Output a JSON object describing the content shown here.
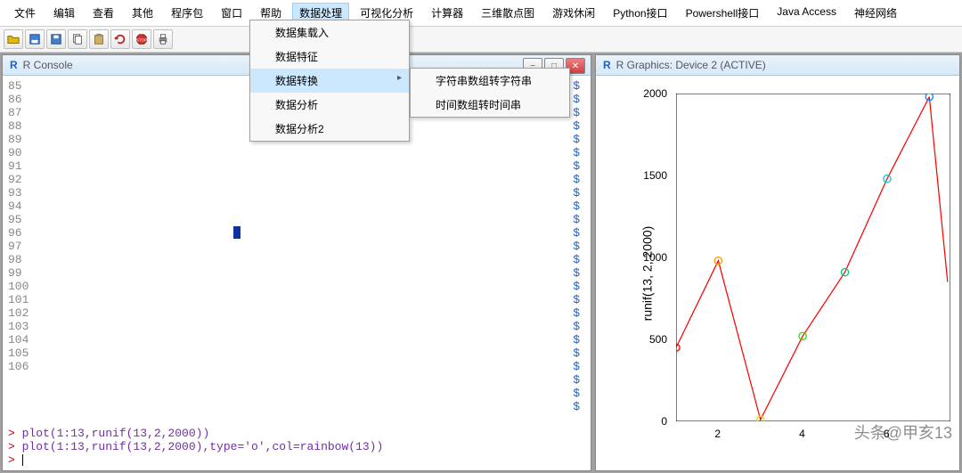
{
  "menubar": [
    "文件",
    "编辑",
    "查看",
    "其他",
    "程序包",
    "窗口",
    "帮助",
    "数据处理",
    "可视化分析",
    "计算器",
    "三维散点图",
    "游戏休闲",
    "Python接口",
    "Powershell接口",
    "Java Access",
    "神经网络"
  ],
  "open_menu_index": 7,
  "dropdown1": [
    "数据集载入",
    "数据特征",
    "数据转换",
    "数据分析",
    "数据分析2"
  ],
  "dropdown1_hover": 2,
  "dropdown2": [
    "字符串数组转字符串",
    "时间数组转时间串"
  ],
  "toolbar_icons": [
    "open-icon",
    "save-as-icon",
    "save-icon",
    "copy-icon",
    "paste-icon",
    "refresh-icon",
    "stop-icon",
    "print-icon"
  ],
  "console": {
    "title": "R Console",
    "line_start": 85,
    "line_end": 106,
    "dollar_count": 25,
    "cmds": [
      "plot(1:13,runif(13,2,2000))",
      "plot(1:13,runif(13,2,2000),type='o',col=rainbow(13))"
    ],
    "prompt": ">"
  },
  "graphics": {
    "title": "R Graphics: Device 2 (ACTIVE)",
    "ylabel": "runif(13, 2, 2000)"
  },
  "watermark": "头条@甲亥13",
  "chart_data": {
    "type": "line",
    "x": [
      1,
      2,
      3,
      4,
      5,
      6,
      7
    ],
    "values": [
      450,
      980,
      10,
      520,
      910,
      1480,
      1980
    ],
    "xlabel": "",
    "ylabel": "runif(13, 2, 2000)",
    "ylim": [
      0,
      2000
    ],
    "yticks": [
      0,
      500,
      1000,
      1500,
      2000
    ],
    "xticks": [
      2,
      4,
      6
    ],
    "point_colors": [
      "#ff0000",
      "#ff9900",
      "#ccee00",
      "#33dd00",
      "#00cc88",
      "#00ccdd",
      "#0088ff"
    ],
    "line_color": "#ff0000",
    "marker": "o"
  }
}
